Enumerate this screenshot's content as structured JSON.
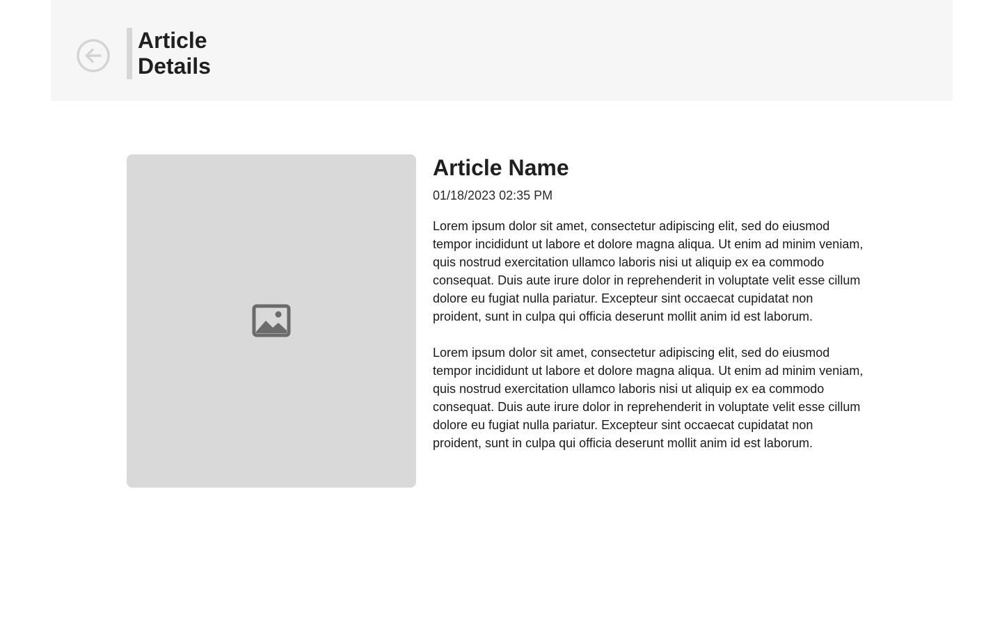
{
  "header": {
    "title": "Article Details",
    "back_icon": "arrow-left-circle-icon"
  },
  "article": {
    "image_icon": "image-icon",
    "name": "Article Name",
    "date": "01/18/2023 02:35 PM",
    "paragraphs": [
      "Lorem ipsum dolor sit amet, consectetur adipiscing elit, sed do eiusmod tempor incididunt ut labore et dolore magna aliqua. Ut enim ad minim veniam, quis nostrud exercitation ullamco laboris nisi ut aliquip ex ea commodo consequat. Duis aute irure dolor in reprehenderit in voluptate velit esse cillum dolore eu fugiat nulla pariatur. Excepteur sint occaecat cupidatat non proident, sunt in culpa qui officia deserunt mollit anim id est laborum.",
      "Lorem ipsum dolor sit amet, consectetur adipiscing elit, sed do eiusmod tempor incididunt ut labore et dolore magna aliqua. Ut enim ad minim veniam, quis nostrud exercitation ullamco laboris nisi ut aliquip ex ea commodo consequat. Duis aute irure dolor in reprehenderit in voluptate velit esse cillum dolore eu fugiat nulla pariatur. Excepteur sint occaecat cupidatat non proident, sunt in culpa qui officia deserunt mollit anim id est laborum."
    ]
  },
  "colors": {
    "header_background": "#f6f6f6",
    "title_accent_bar": "#d6d6d6",
    "image_placeholder": "#d9d9d9",
    "image_icon": "#6b6b6b",
    "back_icon": "#d4d4d4",
    "text": "#1f1f1f"
  }
}
